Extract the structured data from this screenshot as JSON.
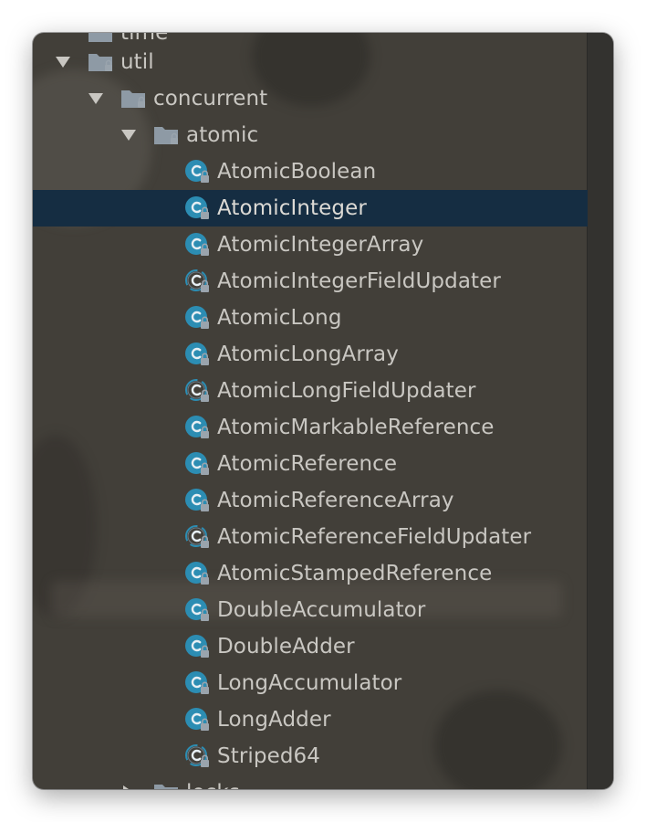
{
  "project_tree": {
    "partial_top_label": "time",
    "util": {
      "label": "util",
      "expanded": true
    },
    "concurrent": {
      "label": "concurrent",
      "expanded": true
    },
    "atomic": {
      "label": "atomic",
      "expanded": true
    },
    "classes": [
      {
        "label": "AtomicBoolean",
        "kind": "class"
      },
      {
        "label": "AtomicInteger",
        "kind": "class",
        "selected": true
      },
      {
        "label": "AtomicIntegerArray",
        "kind": "class"
      },
      {
        "label": "AtomicIntegerFieldUpdater",
        "kind": "abstract-class"
      },
      {
        "label": "AtomicLong",
        "kind": "class"
      },
      {
        "label": "AtomicLongArray",
        "kind": "class"
      },
      {
        "label": "AtomicLongFieldUpdater",
        "kind": "abstract-class"
      },
      {
        "label": "AtomicMarkableReference",
        "kind": "class"
      },
      {
        "label": "AtomicReference",
        "kind": "class"
      },
      {
        "label": "AtomicReferenceArray",
        "kind": "class"
      },
      {
        "label": "AtomicReferenceFieldUpdater",
        "kind": "abstract-class"
      },
      {
        "label": "AtomicStampedReference",
        "kind": "class"
      },
      {
        "label": "DoubleAccumulator",
        "kind": "class"
      },
      {
        "label": "DoubleAdder",
        "kind": "class"
      },
      {
        "label": "LongAccumulator",
        "kind": "class"
      },
      {
        "label": "LongAdder",
        "kind": "class"
      },
      {
        "label": "Striped64",
        "kind": "abstract-class"
      }
    ],
    "partial_bottom_label": "locks"
  },
  "colors": {
    "panel_bg": "#423f39",
    "selection_bg": "#152d42",
    "text": "#c9c7c2",
    "class_icon": "#2c8db3",
    "folder_icon": "#8e9aa5",
    "lock_badge": "#9aa4ad"
  },
  "icons": {
    "expand": "triangle-down-icon",
    "collapse": "triangle-right-icon",
    "folder": "folder-icon",
    "class": "class-icon",
    "abstract_class": "abstract-class-icon",
    "lock": "lock-badge-icon"
  }
}
